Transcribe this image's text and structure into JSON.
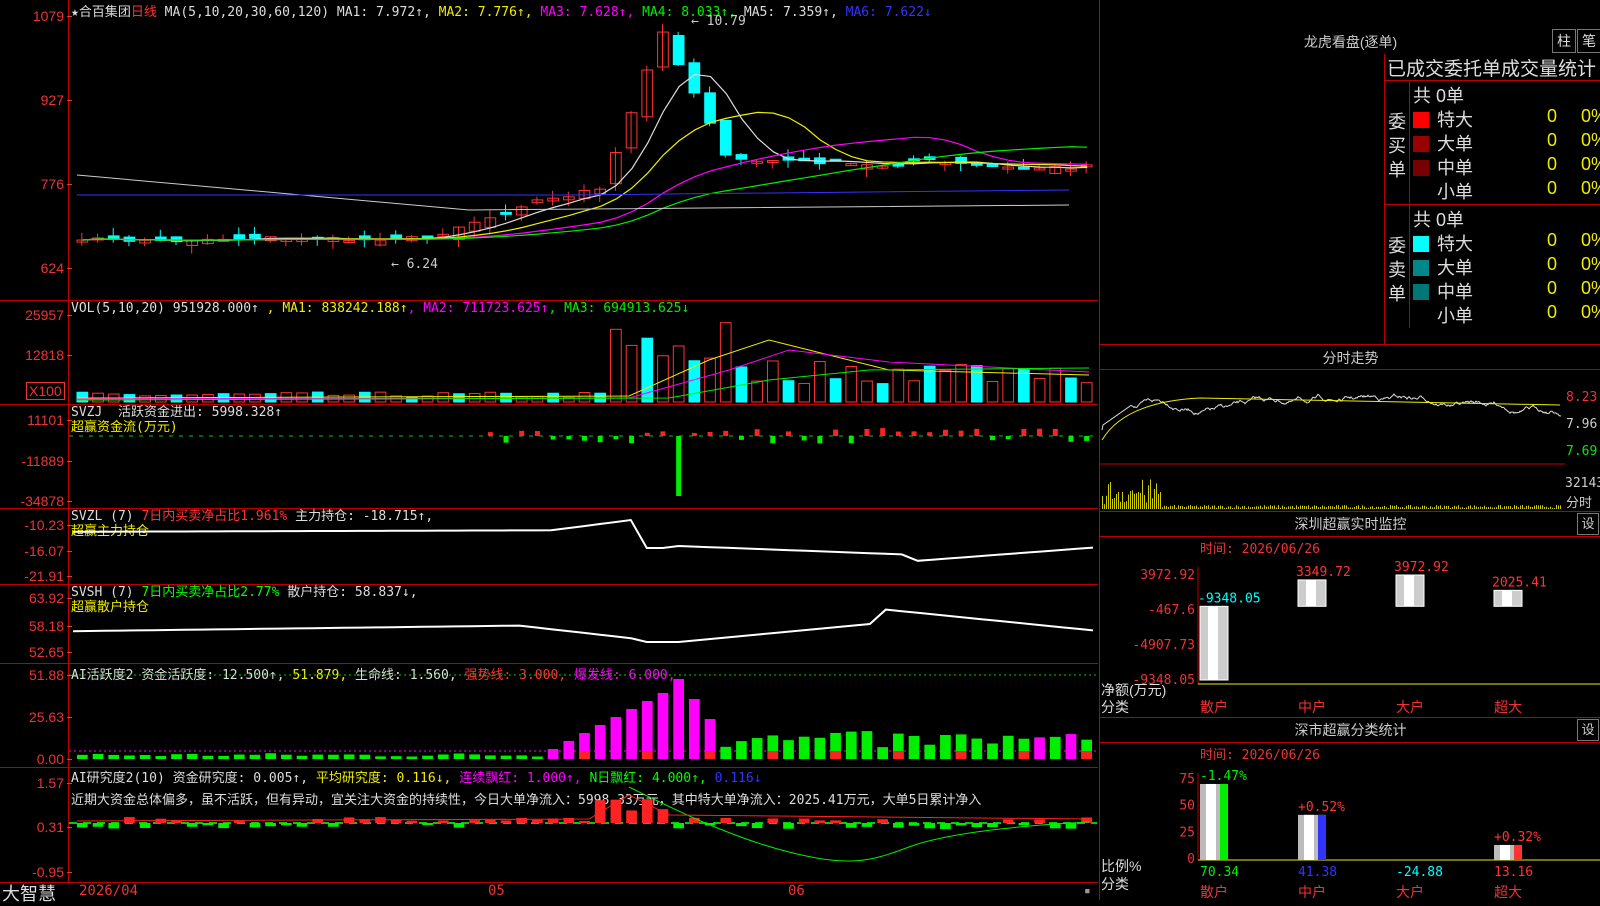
{
  "stock": {
    "name": "★合百集团",
    "period": "日线"
  },
  "kline": {
    "ma_label": "MA(5,10,20,30,60,120)",
    "ma_values": [
      {
        "name": "MA1",
        "value": "7.972↑",
        "color": "#dddddd"
      },
      {
        "name": "MA2",
        "value": "7.776↑",
        "color": "#eeee00"
      },
      {
        "name": "MA3",
        "value": "7.628↑",
        "color": "#ff00ff"
      },
      {
        "name": "MA4",
        "value": "8.033↑",
        "color": "#00ee00"
      },
      {
        "name": "MA5",
        "value": "7.359↑",
        "color": "#dddddd"
      },
      {
        "name": "MA6",
        "value": "7.622↓",
        "color": "#3333ff"
      }
    ],
    "yticks": [
      "1079",
      "927",
      "776",
      "624"
    ],
    "high_label": "10.79",
    "low_label": "6.24"
  },
  "vol": {
    "label": "VOL(5,10,20)",
    "value": "951928.000↑",
    "ma": [
      {
        "name": "MA1",
        "value": "838242.188↑",
        "color": "#eeee00"
      },
      {
        "name": "MA2",
        "value": "711723.625↑",
        "color": "#ff00ff"
      },
      {
        "name": "MA3",
        "value": "694913.625↓",
        "color": "#00ee00"
      }
    ],
    "yticks": [
      "25957",
      "12818"
    ],
    "unit": "X100"
  },
  "svzj": {
    "label": "SVZJ",
    "desc": "活跃资金进出:",
    "value": "5998.328↑",
    "sub": "超赢资金流(万元)",
    "yticks": [
      "11101",
      "-11889",
      "-34878"
    ]
  },
  "svzl": {
    "label": "SVZL (7)",
    "desc": "7日内买卖净占比1.961%",
    "desc2": "主力持仓:",
    "value": "-18.715↑,",
    "sub": "超赢主力持仓",
    "yticks": [
      "-10.23",
      "-16.07",
      "-21.91"
    ]
  },
  "svsh": {
    "label": "SVSH (7)",
    "desc": "7日内买卖净占比2.77%",
    "desc2": "散户持仓:",
    "value": "58.837↓,",
    "sub": "超赢散户持仓",
    "yticks": [
      "63.92",
      "58.18",
      "52.65"
    ]
  },
  "ai_active": {
    "label": "AI活跃度2",
    "desc": "资金活跃度:",
    "v1": "12.500↑,",
    "v2": "51.879,",
    "life": "生命线:",
    "v3": "1.560,",
    "strong": "强势线: 3.000,",
    "burst": "爆发线: 6.000,",
    "yticks": [
      "51.88",
      "25.63",
      "0.00"
    ]
  },
  "ai_research": {
    "label": "AI研究度2(10)",
    "desc": "资金研究度:",
    "v1": "0.005↑,",
    "avg": "平均研究度: 0.116↓,",
    "cont": "连续飘红: 1.000↑,",
    "n": "N日飘红: 4.000↑,",
    "last": "0.116↓",
    "text": "近期大资金总体偏多，虽不活跃，但有异动，宜关注大资金的持续性，今日大单净流入：5998.33万元，其中特大单净流入：2025.41万元，大单5日累计净入",
    "yticks": [
      "1.57",
      "0.31",
      "-0.95"
    ]
  },
  "xaxis": {
    "labels": [
      "2026/04",
      "05",
      "06"
    ]
  },
  "brand": "大智慧",
  "dragon": {
    "title": "龙虎看盘(逐单)",
    "btn1": "柱",
    "btn2": "笔",
    "subtitle": "已成交委托单成交量统计",
    "buy": {
      "side": "委买单",
      "total": "共 0单",
      "rows": [
        {
          "name": "特大",
          "vol": "0",
          "pct": "0%",
          "color": "#ff0000"
        },
        {
          "name": "大单",
          "vol": "0",
          "pct": "0%",
          "color": "#990000"
        },
        {
          "name": "中单",
          "vol": "0",
          "pct": "0%",
          "color": "#770000"
        },
        {
          "name": "小单",
          "vol": "0",
          "pct": "0%",
          "color": "#000000"
        }
      ]
    },
    "sell": {
      "side": "委卖单",
      "total": "共 0单",
      "rows": [
        {
          "name": "特大",
          "vol": "0",
          "pct": "0%",
          "color": "#00ffff"
        },
        {
          "name": "大单",
          "vol": "0",
          "pct": "0%",
          "color": "#008888"
        },
        {
          "name": "中单",
          "vol": "0",
          "pct": "0%",
          "color": "#007777"
        },
        {
          "name": "小单",
          "vol": "0",
          "pct": "0%",
          "color": "#000000"
        }
      ]
    }
  },
  "intraday": {
    "title": "分时走势",
    "prices": [
      "8.23",
      "7.96",
      "7.69"
    ],
    "vol": "32143",
    "unit": "分时"
  },
  "sz_monitor": {
    "title": "深圳超赢实时监控",
    "setting": "设",
    "time": "时间: 2026/06/26",
    "yticks": [
      "3972.92",
      "-467.6",
      "-4907.73",
      "-9348.05"
    ],
    "ylabel": "净额(万元)",
    "xlabel": "分类",
    "cats": [
      "散户",
      "中户",
      "大户",
      "超大"
    ],
    "values": [
      "-9348.05",
      "3349.72",
      "3972.92",
      "2025.41"
    ]
  },
  "sz_class": {
    "title": "深市超赢分类统计",
    "setting": "设",
    "time": "时间: 2026/06/26",
    "yticks": [
      "75",
      "50",
      "25",
      "0"
    ],
    "ylabel": "比例%",
    "xlabel": "分类",
    "cats": [
      "散户",
      "中户",
      "大户",
      "超大"
    ],
    "top": [
      "-1.47%",
      "+0.52%",
      "",
      "+0.32%"
    ],
    "bottom": [
      "70.34",
      "41.38",
      "-24.88",
      "13.16"
    ]
  },
  "chart_data": [
    {
      "type": "bar",
      "title": "深圳超赢实时监控",
      "categories": [
        "散户",
        "中户",
        "大户",
        "超大"
      ],
      "values": [
        -9348.05,
        3349.72,
        3972.92,
        2025.41
      ],
      "ylabel": "净额(万元)",
      "xlabel": "分类",
      "ylim": [
        -9348.05,
        3972.92
      ]
    },
    {
      "type": "bar",
      "title": "深市超赢分类统计",
      "categories": [
        "散户",
        "中户",
        "大户",
        "超大"
      ],
      "values": [
        70.34,
        41.38,
        -24.88,
        13.16
      ],
      "ylabel": "比例%",
      "xlabel": "分类",
      "ylim": [
        0,
        75
      ]
    }
  ]
}
